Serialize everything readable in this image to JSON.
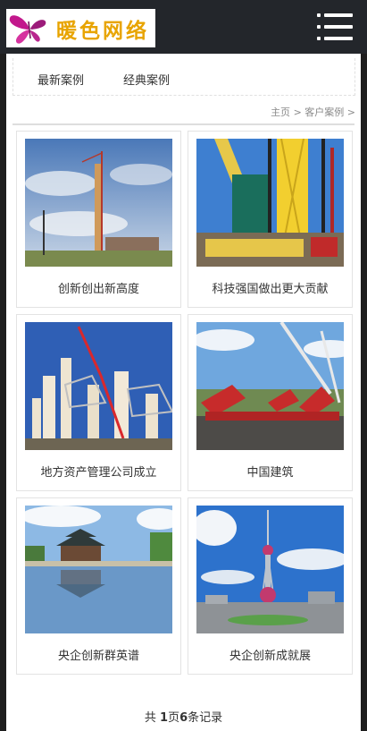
{
  "header": {
    "logo_text": "暖色网络"
  },
  "tabs": [
    {
      "label": "最新案例"
    },
    {
      "label": "经典案例"
    }
  ],
  "breadcrumb": {
    "home": "主页",
    "separator": ">",
    "current": "客户案例"
  },
  "cases": [
    {
      "caption": "创新创出新高度"
    },
    {
      "caption": "科技强国做出更大贡献"
    },
    {
      "caption": "地方资产管理公司成立"
    },
    {
      "caption": "中国建筑"
    },
    {
      "caption": "央企创新群英谱"
    },
    {
      "caption": "央企创新成就展"
    }
  ],
  "pagination": {
    "prefix": "共",
    "pages": "1",
    "pages_unit": "页",
    "records": "6",
    "records_unit": "条记录"
  },
  "colors": {
    "header_bg": "#23262b",
    "logo_text": "#e8a400",
    "page_bg": "#ffffff",
    "border": "#e3e3e3"
  }
}
